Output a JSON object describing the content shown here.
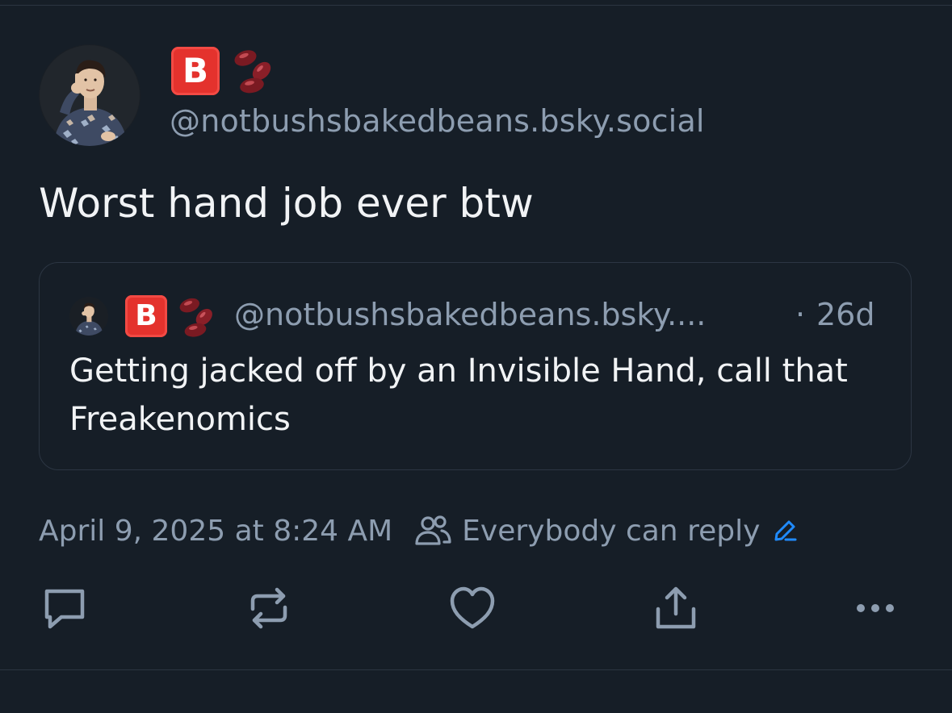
{
  "post": {
    "author": {
      "badge_letter": "B",
      "handle": "@notbushsbakedbeans.bsky.social"
    },
    "text": "Worst hand job ever btw",
    "quoted_post": {
      "badge_letter": "B",
      "handle": "@notbushsbakedbeans.bsky....",
      "separator": "·",
      "relative_time": "26d",
      "text": "Getting jacked off by an Invisible Hand, call that Freakenomics"
    },
    "timestamp": "April 9, 2025 at 8:24 AM",
    "reply_setting": "Everybody can reply"
  },
  "icons": {
    "people": "people-icon",
    "edit": "pencil-icon",
    "reply": "reply-icon",
    "repost": "repost-icon",
    "like": "heart-icon",
    "share": "share-icon",
    "more": "more-icon",
    "beans": "beans-emoji"
  },
  "colors": {
    "background": "#161e27",
    "text_primary": "#f1f3f5",
    "text_secondary": "#8d9db0",
    "accent": "#208bfe",
    "badge_red": "#e4322d"
  }
}
